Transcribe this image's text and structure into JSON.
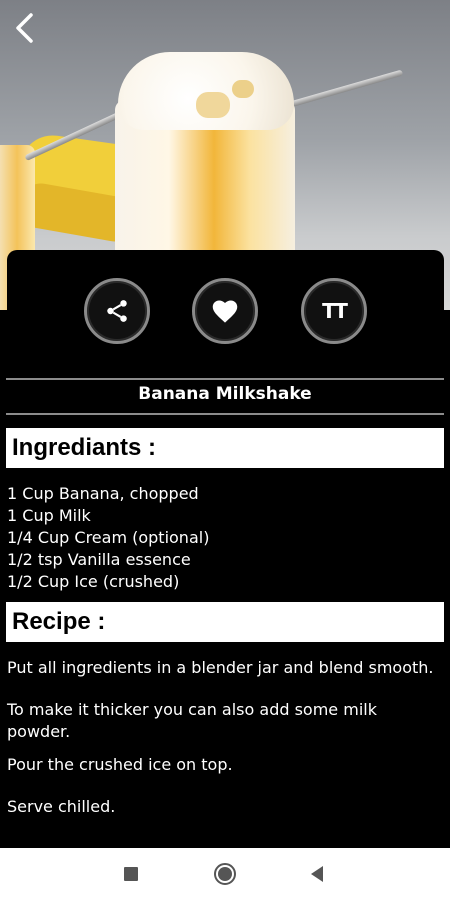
{
  "hero": {
    "image_icon": "banana-milkshake-photo"
  },
  "header": {
    "back_icon": "chevron-left-icon"
  },
  "actions": [
    {
      "icon": "share-icon"
    },
    {
      "icon": "heart-icon"
    },
    {
      "icon": "text-size-icon",
      "label": "TT"
    }
  ],
  "recipe": {
    "title": "Banana Milkshake",
    "ingredients_heading": "Ingrediants :",
    "ingredients": [
      "1 Cup Banana, chopped",
      "1 Cup Milk",
      "1/4 Cup Cream (optional)",
      "1/2 tsp Vanilla essence",
      "1/2 Cup Ice (crushed)"
    ],
    "recipe_heading": "Recipe :",
    "steps": [
      "Put all ingredients in a blender jar and blend smooth.",
      "To make it thicker you can also add some milk powder.",
      "Pour the crushed ice on top.",
      "Serve chilled."
    ]
  },
  "navbar": {
    "recent_icon": "square-icon",
    "home_icon": "circle-icon",
    "back_icon": "triangle-back-icon"
  }
}
